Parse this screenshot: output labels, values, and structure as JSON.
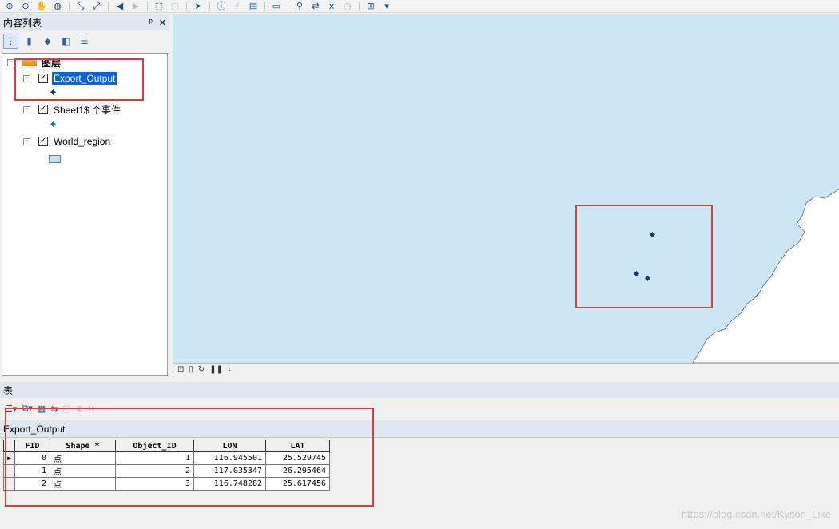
{
  "toc": {
    "title": "内容列表",
    "pin": "ᵖ",
    "close": "✕",
    "root_label": "图层",
    "layers": [
      {
        "name": "Export_Output",
        "checked": "✓",
        "symbol_color": "#1c3a6b"
      },
      {
        "name": "Sheet1$ 个事件",
        "checked": "✓",
        "symbol_color": "#1f7a7a"
      },
      {
        "name": "World_region",
        "checked": "✓",
        "symbol_color": "#c9dff0"
      }
    ]
  },
  "table": {
    "window_title": "表",
    "tab_label": "Export_Output",
    "columns": [
      "FID",
      "Shape *",
      "Object_ID",
      "LON",
      "LAT"
    ],
    "rows": [
      {
        "FID": "0",
        "Shape": "点",
        "Object_ID": "1",
        "LON": "116.945501",
        "LAT": "25.529745"
      },
      {
        "FID": "1",
        "Shape": "点",
        "Object_ID": "2",
        "LON": "117.035347",
        "LAT": "26.295464"
      },
      {
        "FID": "2",
        "Shape": "点",
        "Object_ID": "3",
        "LON": "116.748282",
        "LAT": "25.617456"
      }
    ]
  },
  "colors": {
    "map_water": "#cde6f6",
    "annotation_red": "#e0383b",
    "selection_blue": "#0a64d8"
  },
  "watermark": "https://blog.csdn.net/Kyson_Like"
}
